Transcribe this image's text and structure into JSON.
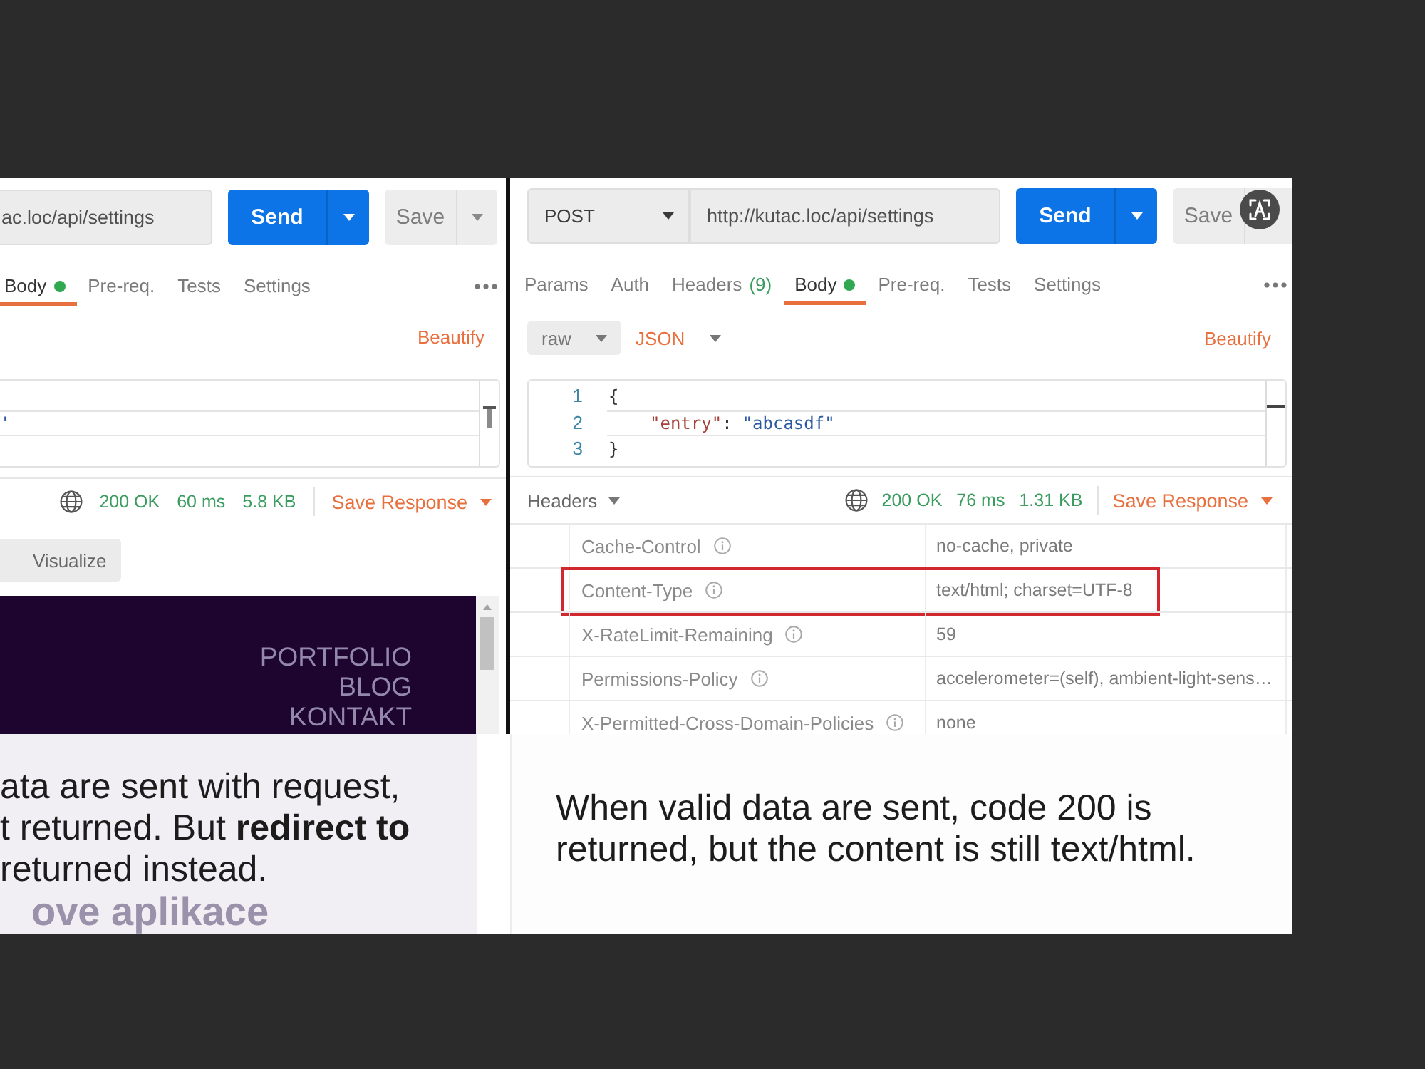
{
  "left_panel": {
    "request": {
      "url": "ac.loc/api/settings",
      "send": "Send",
      "save": "Save"
    },
    "tabs": [
      {
        "label": "Body",
        "selected": true,
        "indicator": true
      },
      {
        "label": "Pre-req.",
        "selected": false,
        "indicator": false
      },
      {
        "label": "Tests",
        "selected": false,
        "indicator": false
      },
      {
        "label": "Settings",
        "selected": false,
        "indicator": false
      }
    ],
    "beautify": "Beautify",
    "editor": {
      "lines": [
        {
          "active": false
        },
        {
          "active": true,
          "tokens": [
            {
              "kind": "string",
              "text": "'"
            }
          ]
        },
        {
          "active": false
        }
      ]
    },
    "response": {
      "status": "200 OK",
      "time": "60 ms",
      "size": "5.8 KB",
      "save_response": "Save Response",
      "view_mode": "Visualize"
    },
    "preview": {
      "nav": [
        "PORTFOLIO",
        "BLOG",
        "KONTAKT"
      ],
      "heading": "ove aplikace"
    }
  },
  "right_panel": {
    "request": {
      "method": "POST",
      "url": "http://kutac.loc/api/settings",
      "send": "Send",
      "save": "Save"
    },
    "tabs": [
      {
        "label": "Params",
        "selected": false,
        "indicator": false
      },
      {
        "label": "Auth",
        "selected": false,
        "indicator": false
      },
      {
        "label": "Headers",
        "count": "(9)",
        "selected": false,
        "indicator": false
      },
      {
        "label": "Body",
        "selected": true,
        "indicator": true
      },
      {
        "label": "Pre-req.",
        "selected": false,
        "indicator": false
      },
      {
        "label": "Tests",
        "selected": false,
        "indicator": false
      },
      {
        "label": "Settings",
        "selected": false,
        "indicator": false
      }
    ],
    "body_type": "raw",
    "language": "JSON",
    "beautify": "Beautify",
    "editor": {
      "lines": [
        {
          "number": "1",
          "active": false,
          "tokens": [
            {
              "kind": "punct",
              "text": "{"
            }
          ]
        },
        {
          "number": "2",
          "active": true,
          "tokens": [
            {
              "kind": "key",
              "text": "\"entry\""
            },
            {
              "kind": "punct",
              "text": ":"
            },
            {
              "kind": "string",
              "text": "\"abcasdf\""
            }
          ]
        },
        {
          "number": "3",
          "active": false,
          "tokens": [
            {
              "kind": "punct",
              "text": "}"
            }
          ]
        }
      ]
    },
    "response": {
      "section": "Headers",
      "status": "200 OK",
      "time": "76 ms",
      "size": "1.31 KB",
      "save_response": "Save Response"
    },
    "headers": [
      {
        "name": "Cache-Control",
        "value": "no-cache, private",
        "highlighted": false
      },
      {
        "name": "Content-Type",
        "value": "text/html; charset=UTF-8",
        "highlighted": true
      },
      {
        "name": "X-RateLimit-Remaining",
        "value": "59",
        "highlighted": false
      },
      {
        "name": "Permissions-Policy",
        "value": "accelerometer=(self), ambient-light-sens…",
        "highlighted": false
      },
      {
        "name": "X-Permitted-Cross-Domain-Policies",
        "value": "none",
        "highlighted": false
      }
    ]
  },
  "captions": [
    {
      "text": "ata are sent with request,\nt returned. But **redirect to**\nreturned instead."
    },
    {
      "text": "When valid data are sent, code 200 is\nreturned, but the content is still text/html."
    }
  ]
}
